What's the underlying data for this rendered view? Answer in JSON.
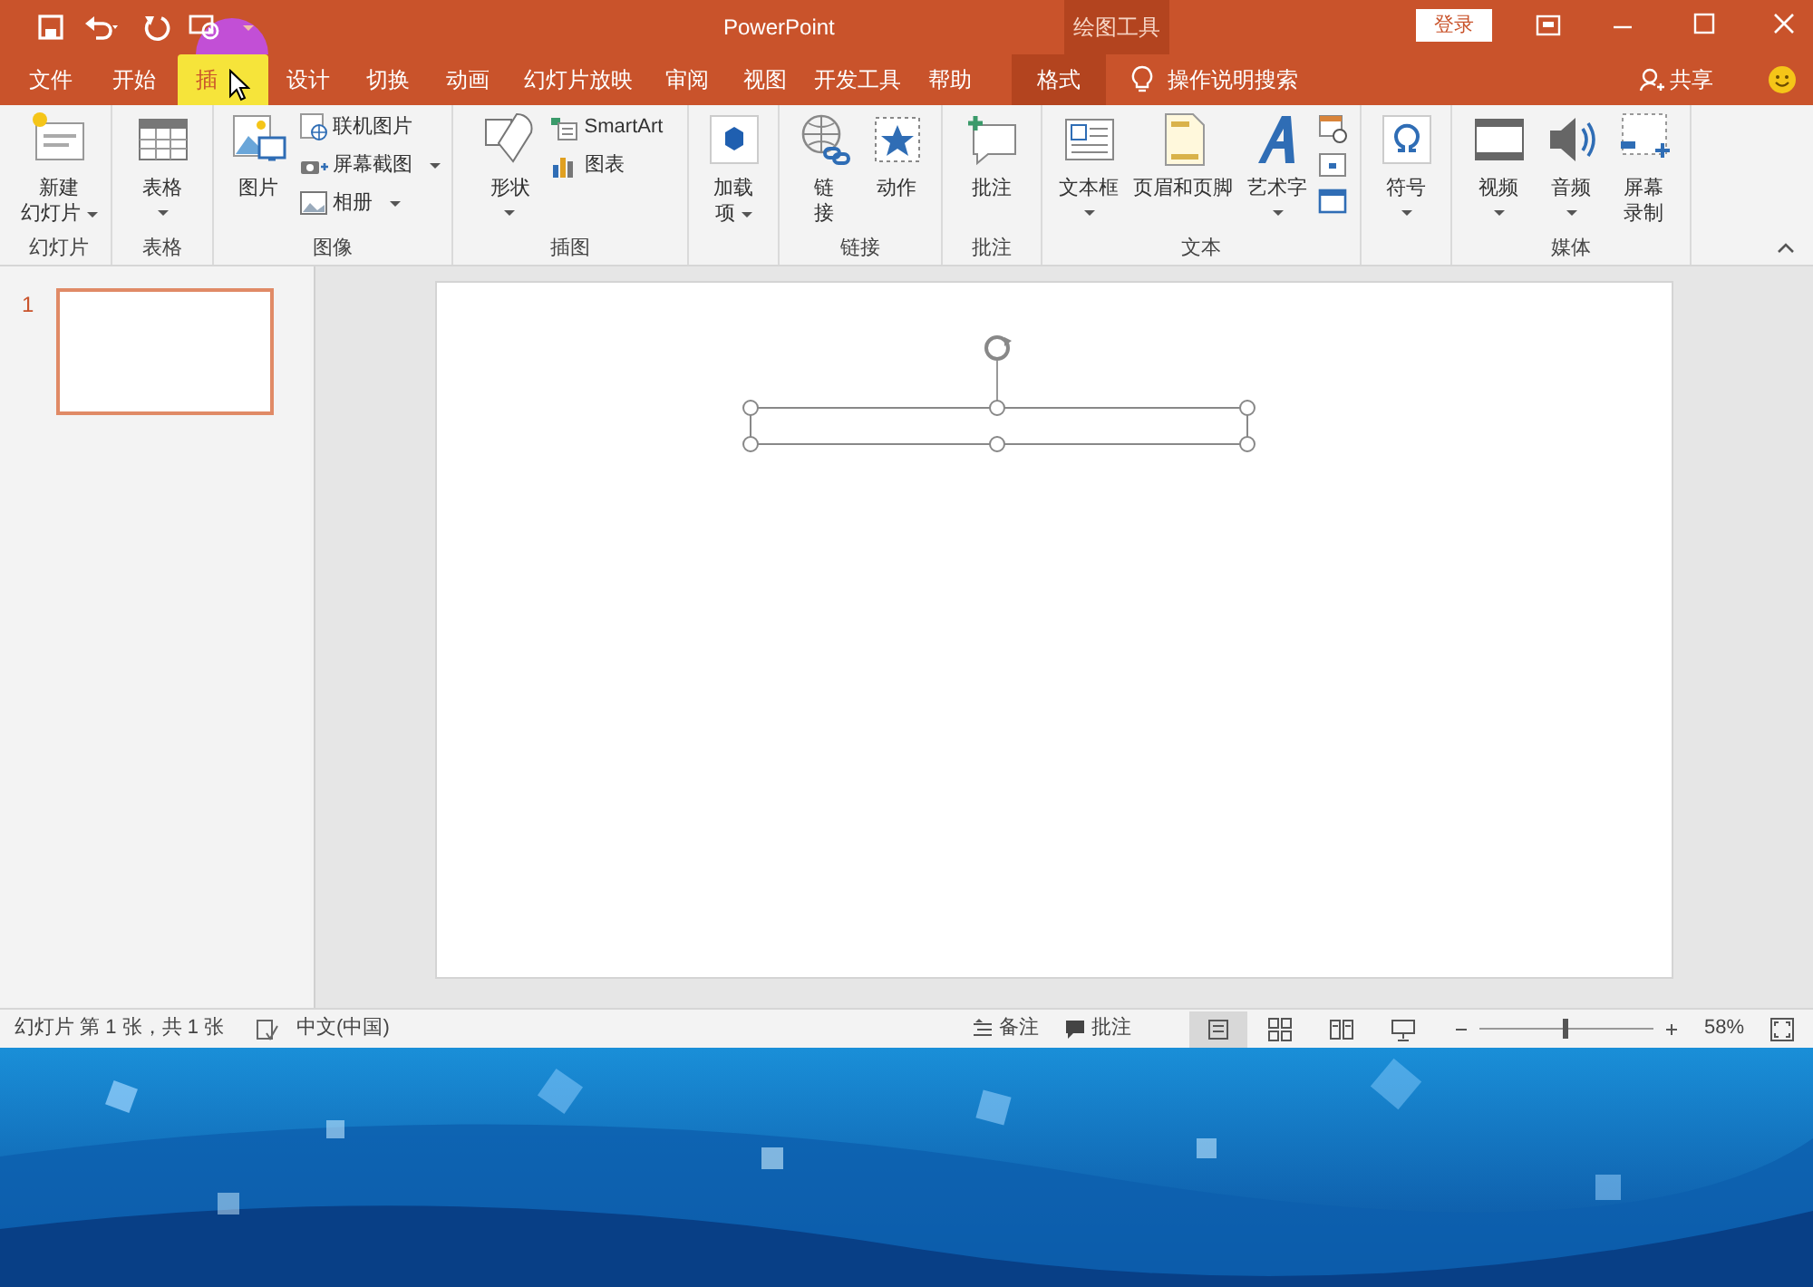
{
  "title_bar": {
    "title": "PowerPoint",
    "context_group": "绘图工具",
    "login": "登录"
  },
  "tabs": [
    {
      "label": "文件",
      "selected": false,
      "kind": "normal"
    },
    {
      "label": "开始",
      "selected": false,
      "kind": "normal"
    },
    {
      "label": "插",
      "selected": true,
      "kind": "normal"
    },
    {
      "label": "设计",
      "selected": false,
      "kind": "normal"
    },
    {
      "label": "切换",
      "selected": false,
      "kind": "normal"
    },
    {
      "label": "动画",
      "selected": false,
      "kind": "normal"
    },
    {
      "label": "幻灯片放映",
      "selected": false,
      "kind": "normal"
    },
    {
      "label": "审阅",
      "selected": false,
      "kind": "normal"
    },
    {
      "label": "视图",
      "selected": false,
      "kind": "normal"
    },
    {
      "label": "开发工具",
      "selected": false,
      "kind": "normal"
    },
    {
      "label": "帮助",
      "selected": false,
      "kind": "normal"
    },
    {
      "label": "格式",
      "selected": false,
      "kind": "context"
    }
  ],
  "tell_me": "操作说明搜索",
  "share": "共享",
  "ribbon_groups": [
    {
      "label": "幻灯片",
      "items": [
        {
          "kind": "large",
          "label_lines": [
            "新建",
            "幻灯片"
          ],
          "dropdown": true
        }
      ]
    },
    {
      "label": "表格",
      "items": [
        {
          "kind": "large",
          "label": "表格",
          "dropdown": true
        }
      ]
    },
    {
      "label": "图像",
      "items": [
        {
          "kind": "large",
          "label": "图片",
          "dropdown": false
        },
        {
          "kind": "small",
          "label": "联机图片",
          "dropdown": false
        },
        {
          "kind": "small",
          "label": "屏幕截图",
          "dropdown": true
        },
        {
          "kind": "small",
          "label": "相册",
          "dropdown": true
        }
      ]
    },
    {
      "label": "插图",
      "items": [
        {
          "kind": "large",
          "label": "形状",
          "dropdown": true
        },
        {
          "kind": "small",
          "label": "SmartArt",
          "dropdown": false
        },
        {
          "kind": "small",
          "label": "图表",
          "dropdown": false
        }
      ]
    },
    {
      "items": [
        {
          "kind": "large",
          "label_lines": [
            "加载",
            "项"
          ],
          "dropdown": true
        }
      ]
    },
    {
      "label": "链接",
      "items": [
        {
          "kind": "large",
          "label_lines": [
            "链",
            "接"
          ],
          "dropdown": false
        },
        {
          "kind": "large",
          "label": "动作",
          "dropdown": false
        }
      ]
    },
    {
      "label": "批注",
      "items": [
        {
          "kind": "large",
          "label": "批注",
          "dropdown": false
        }
      ]
    },
    {
      "label": "文本",
      "items": [
        {
          "kind": "large",
          "label": "文本框",
          "dropdown": true
        },
        {
          "kind": "large",
          "label": "页眉和页脚",
          "dropdown": false
        },
        {
          "kind": "large",
          "label": "艺术字",
          "dropdown": true
        },
        {
          "kind": "icon"
        },
        {
          "kind": "icon"
        },
        {
          "kind": "icon"
        }
      ]
    },
    {
      "items": [
        {
          "kind": "large",
          "label": "符号",
          "dropdown": true
        }
      ]
    },
    {
      "label": "媒体",
      "items": [
        {
          "kind": "large",
          "label": "视频",
          "dropdown": true
        },
        {
          "kind": "large",
          "label": "音频",
          "dropdown": true
        },
        {
          "kind": "large",
          "label_lines": [
            "屏幕",
            "录制"
          ],
          "dropdown": false
        }
      ]
    }
  ],
  "thumbnails": [
    {
      "number": "1",
      "selected": true
    }
  ],
  "status_bar": {
    "slide_info": "幻灯片 第 1 张，共 1 张",
    "language": "中文(中国)",
    "notes": "备注",
    "comments": "批注",
    "views": [
      {
        "selected": true
      },
      {
        "selected": false
      },
      {
        "selected": false
      },
      {
        "selected": false
      }
    ],
    "zoom": {
      "level": 0.5,
      "reading": "58%"
    }
  }
}
